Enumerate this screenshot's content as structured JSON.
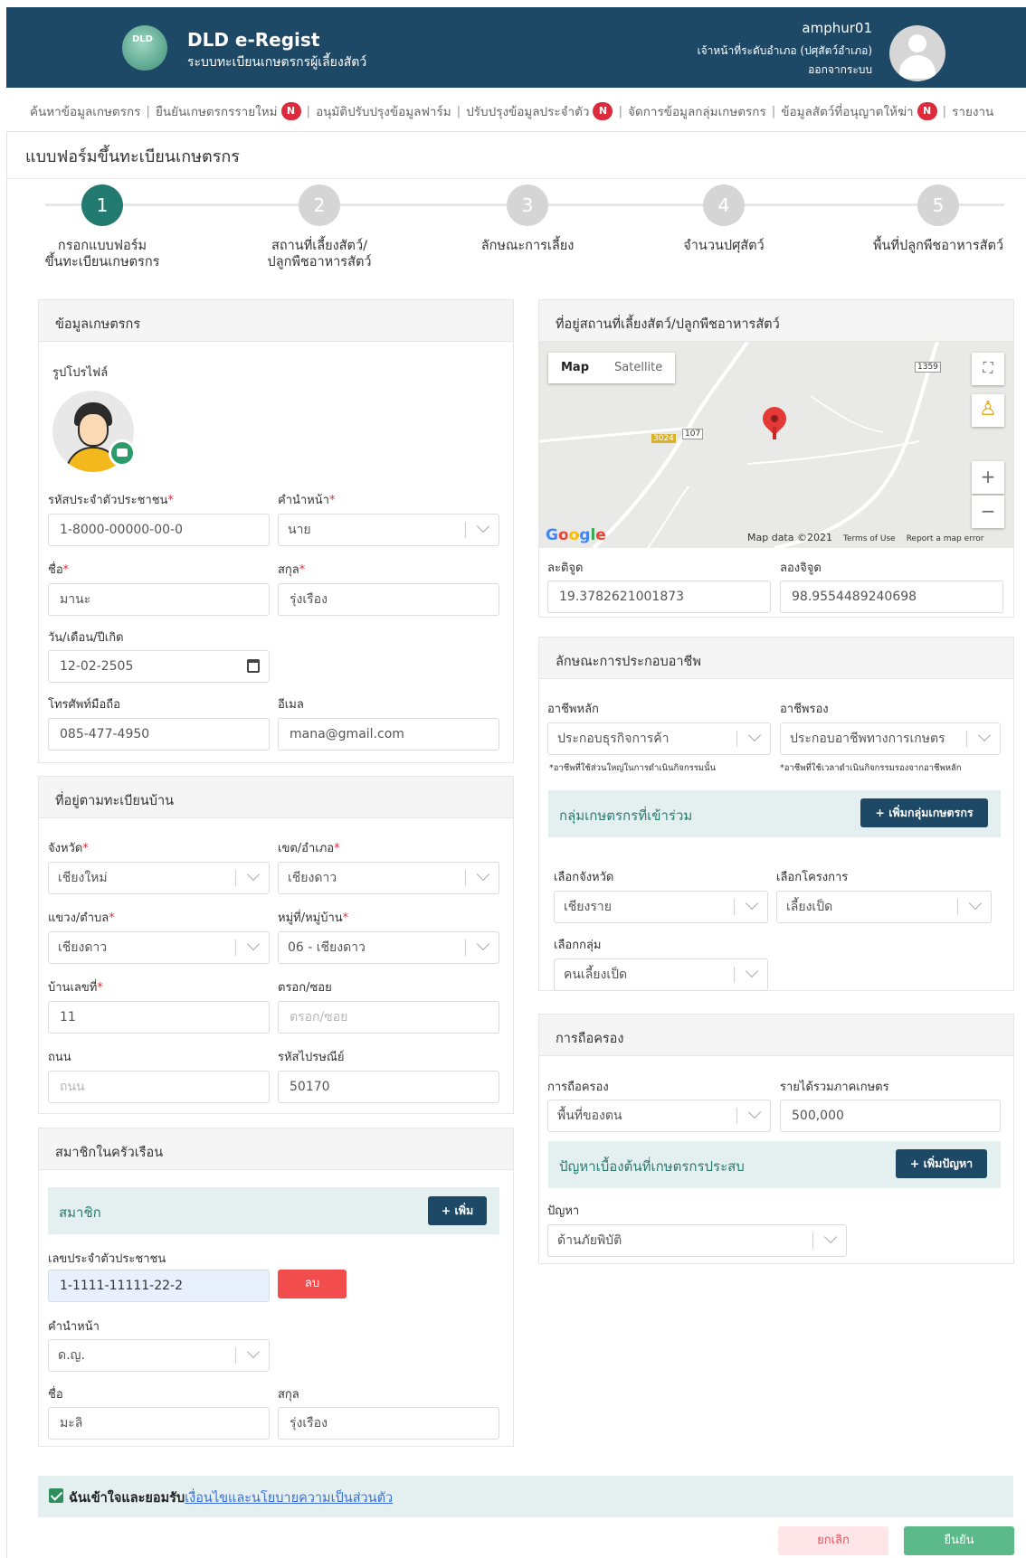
{
  "header": {
    "logo_text": "DLD",
    "app_title": "DLD e-Regist",
    "app_subtitle": "ระบบทะเบียนเกษตรกรผู้เลี้ยงสัตว์",
    "username": "amphur01",
    "user_role": "เจ้าหน้าที่ระดับอำเภอ (ปศุสัตว์อำเภอ)",
    "logout": "ออกจากระบบ"
  },
  "nav": {
    "items": [
      {
        "label": "ค้นหาข้อมูลเกษตรกร",
        "badge": ""
      },
      {
        "label": "ยืนยันเกษตรกรรายใหม่",
        "badge": "N"
      },
      {
        "label": "อนุมัติปรับปรุงข้อมูลฟาร์ม",
        "badge": ""
      },
      {
        "label": "ปรับปรุงข้อมูลประจำตัว",
        "badge": "N"
      },
      {
        "label": "จัดการข้อมูลกลุ่มเกษตรกร",
        "badge": ""
      },
      {
        "label": "ข้อมูลสัตว์ที่อนุญาตให้ฆ่า",
        "badge": "N"
      },
      {
        "label": "รายงาน",
        "badge": ""
      }
    ]
  },
  "form_title": "แบบฟอร์มขึ้นทะเบียนเกษตรกร",
  "steps": [
    {
      "num": "1",
      "label1": "กรอกแบบฟอร์ม",
      "label2": "ขึ้นทะเบียนเกษตรกร"
    },
    {
      "num": "2",
      "label1": "สถานที่เลี้ยงสัตว์/",
      "label2": "ปลูกพืชอาหารสัตว์"
    },
    {
      "num": "3",
      "label1": "ลักษณะการเลี้ยง",
      "label2": ""
    },
    {
      "num": "4",
      "label1": "จำนวนปศุสัตว์",
      "label2": ""
    },
    {
      "num": "5",
      "label1": "พื้นที่ปลูกพืชอาหารสัตว์",
      "label2": ""
    }
  ],
  "farmer": {
    "title": "ข้อมูลเกษตรกร",
    "profile_label": "รูปโปรไฟล์",
    "id_label": "รหัสประจำตัวประชาชน",
    "id_value": "1-8000-00000-00-0",
    "prefix_label": "คำนำหน้า",
    "prefix_value": "นาย",
    "first_label": "ชื่อ",
    "first_value": "มานะ",
    "last_label": "สกุล",
    "last_value": "รุ่งเรือง",
    "dob_label": "วัน/เดือน/ปีเกิด",
    "dob_value": "12-02-2505",
    "phone_label": "โทรศัพท์มือถือ",
    "phone_value": "085-477-4950",
    "email_label": "อีเมล",
    "email_value": "mana@gmail.com"
  },
  "address": {
    "title": "ที่อยู่ตามทะเบียนบ้าน",
    "province_label": "จังหวัด",
    "province_value": "เชียงใหม่",
    "district_label": "เขต/อำเภอ",
    "district_value": "เชียงดาว",
    "subdistrict_label": "แขวง/ตำบล",
    "subdistrict_value": "เชียงดาว",
    "village_label": "หมู่ที่/หมู่บ้าน",
    "village_value": "06 - เชียงดาว",
    "house_label": "บ้านเลขที่",
    "house_value": "11",
    "alley_label": "ตรอก/ซอย",
    "alley_placeholder": "ตรอก/ซอย",
    "road_label": "ถนน",
    "road_placeholder": "ถนน",
    "postal_label": "รหัสไปรษณีย์",
    "postal_value": "50170"
  },
  "household": {
    "title": "สมาชิกในครัวเรือน",
    "members_label": "สมาชิก",
    "add_button": "+ เพิ่ม",
    "id_label": "เลขประจำตัวประชาชน",
    "id_value": "1-1111-11111-22-2",
    "delete_button": "ลบ",
    "prefix_label": "คำนำหน้า",
    "prefix_value": "ด.ญ.",
    "first_label": "ชื่อ",
    "first_value": "มะลิ",
    "last_label": "สกุล",
    "last_value": "รุ่งเรือง"
  },
  "location": {
    "title": "ที่อยู่สถานที่เลี้ยงสัตว์/ปลูกพืชอาหารสัตว์",
    "map_tab": "Map",
    "satellite_tab": "Satellite",
    "google": "Google",
    "map_data": "Map data ©2021",
    "terms": "Terms of Use",
    "report": "Report a map error",
    "road_1359": "1359",
    "road_107": "107",
    "road_3024": "3024",
    "lat_label": "ละติจูด",
    "lat_value": "19.3782621001873",
    "lng_label": "ลองจิจูด",
    "lng_value": "98.9554489240698"
  },
  "occupation": {
    "title": "ลักษณะการประกอบอาชีพ",
    "main_label": "อาชีพหลัก",
    "main_value": "ประกอบธุรกิจการค้า",
    "main_note": "*อาชีพที่ใช้ส่วนใหญ่ในการดำเนินกิจกรรมนั้น",
    "second_label": "อาชีพรอง",
    "second_value": "ประกอบอาชีพทางการเกษตร",
    "second_note": "*อาชีพที่ใช้เวลาดำเนินกิจกรรมรองจากอาชีพหลัก",
    "group_bar": "กลุ่มเกษตรกรที่เข้าร่วม",
    "add_group_button": "+ เพิ่มกลุ่มเกษตรกร",
    "prov_label": "เลือกจังหวัด",
    "prov_value": "เชียงราย",
    "project_label": "เลือกโครงการ",
    "project_value": "เลี้ยงเป็ด",
    "grp_label": "เลือกกลุ่ม",
    "grp_value": "คนเลี้ยงเป็ด"
  },
  "holding": {
    "title": "การถือครอง",
    "holding_label": "การถือครอง",
    "holding_value": "พื้นที่ของตน",
    "income_label": "รายได้รวมภาคเกษตร",
    "income_value": "500,000",
    "problem_bar": "ปัญหาเบื้องต้นที่เกษตรกรประสบ",
    "add_problem_button": "+ เพิ่มปัญหา",
    "problem_label": "ปัญหา",
    "problem_value": "ด้านภัยพิบัติ"
  },
  "consent": {
    "text": "ฉันเข้าใจและยอมรับ",
    "link": "เงื่อนไขและนโยบายความเป็นส่วนตัว"
  },
  "actions": {
    "cancel": "ยกเลิก",
    "confirm": "ยืนยัน"
  }
}
